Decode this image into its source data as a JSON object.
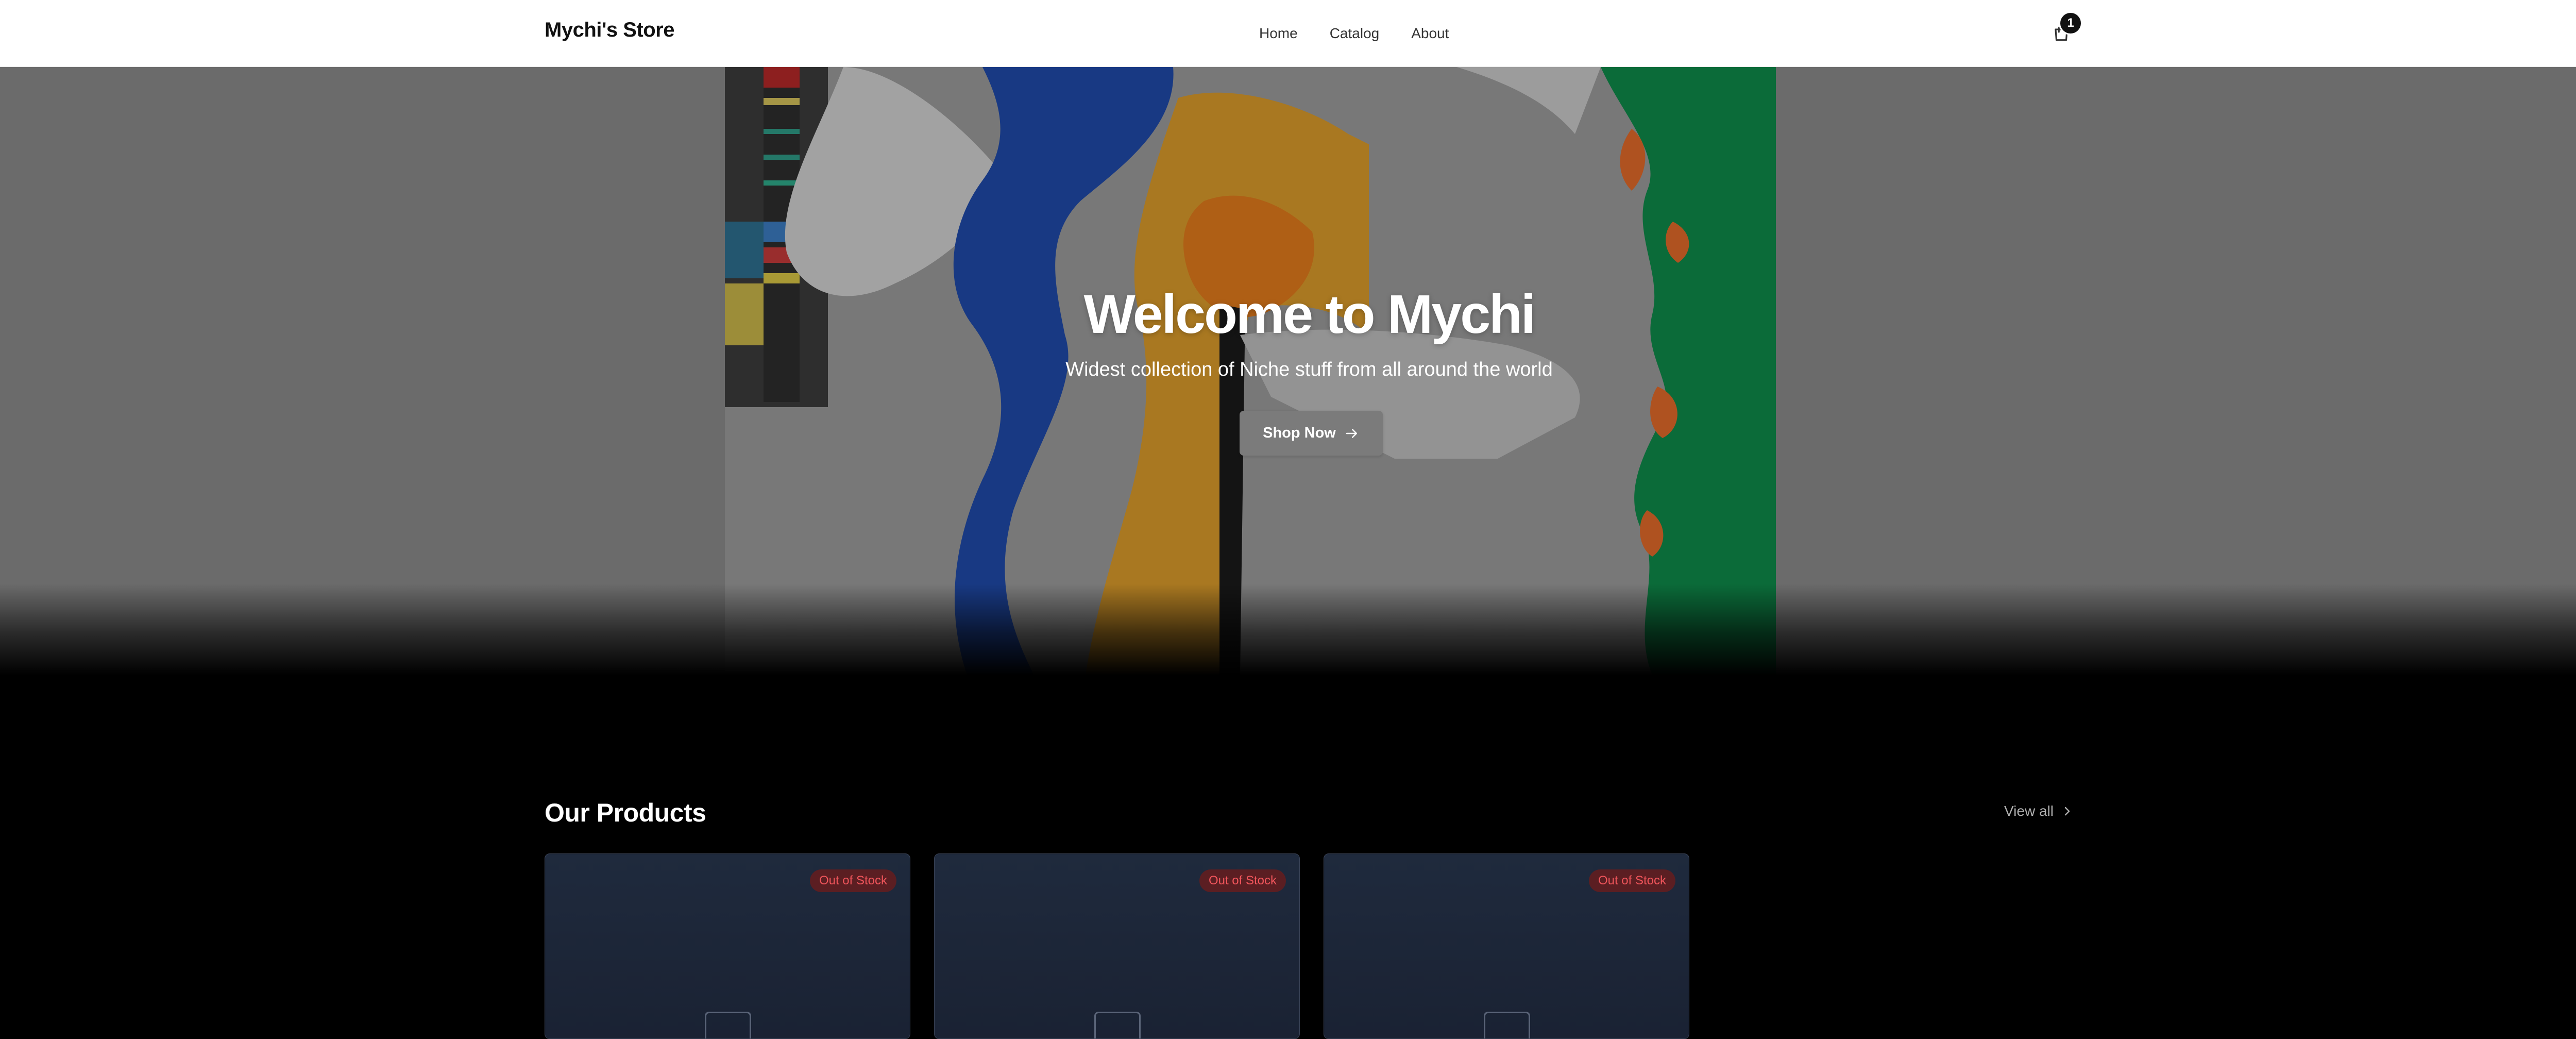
{
  "header": {
    "brand": "Mychi's Store",
    "nav": [
      "Home",
      "Catalog",
      "About"
    ],
    "cart_count": "1"
  },
  "hero": {
    "title": "Welcome to Mychi",
    "subtitle": "Widest collection of Niche stuff from all around the world",
    "cta_label": "Shop Now"
  },
  "products": {
    "title": "Our Products",
    "view_all_label": "View all",
    "cards": [
      {
        "badge": "Out of Stock"
      },
      {
        "badge": "Out of Stock"
      },
      {
        "badge": "Out of Stock"
      }
    ]
  },
  "colors": {
    "header_bg": "#ffffff",
    "page_bg": "#000000",
    "badge_text": "#f0555b",
    "badge_bg": "#5b1e22",
    "card_bg": "#1f2a3d"
  },
  "icons": {
    "cart": "shopping-bag-icon",
    "cta_arrow": "arrow-right-icon",
    "view_all_arrow": "chevron-right-icon",
    "card_placeholder": "image-placeholder-icon"
  }
}
